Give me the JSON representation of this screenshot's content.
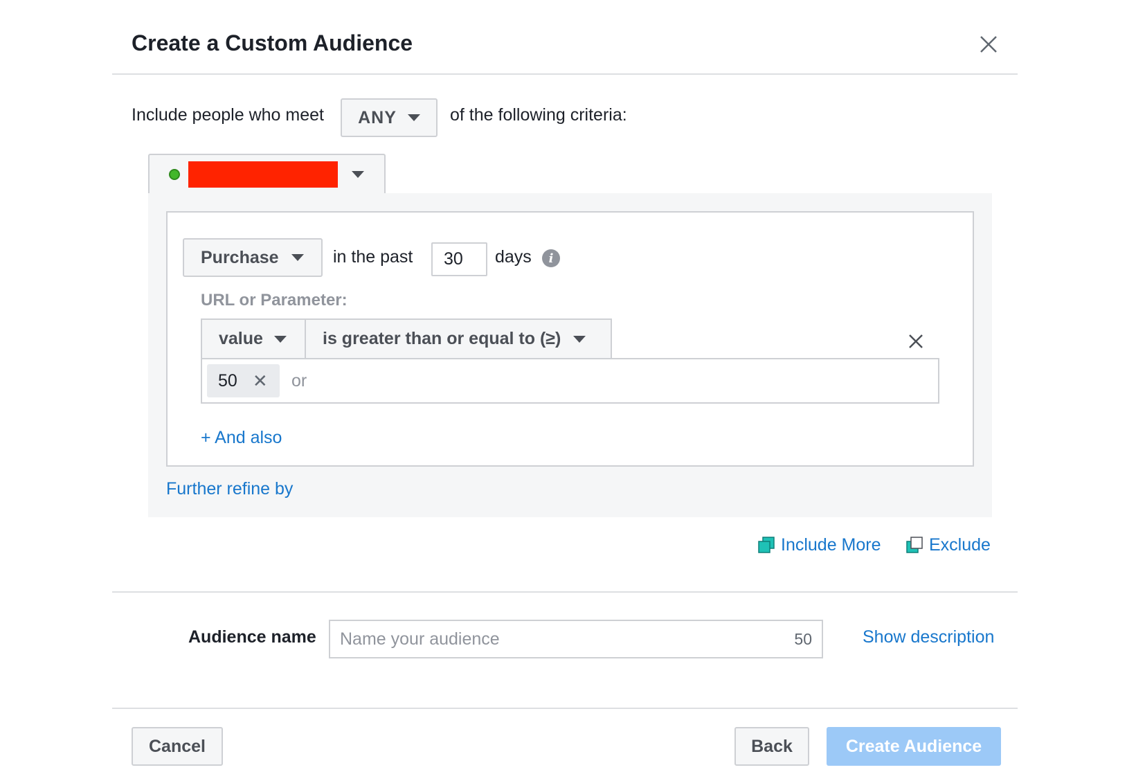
{
  "dialog": {
    "title": "Create a Custom Audience"
  },
  "criteria": {
    "prefix": "Include people who meet",
    "match_mode": "ANY",
    "suffix": "of the following criteria:"
  },
  "rule": {
    "event": "Purchase",
    "in_the_past_label": "in the past",
    "days_value": "30",
    "days_label": "days",
    "info_glyph": "i",
    "param_label": "URL or Parameter:",
    "param_key": "value",
    "operator": "is greater than or equal to (≥)",
    "tokens": [
      {
        "label": "50"
      }
    ],
    "or_label": "or",
    "and_also_link": "+ And also",
    "further_refine_link": "Further refine by"
  },
  "actions": {
    "include_more": "Include More",
    "exclude": "Exclude"
  },
  "audience_name": {
    "label": "Audience name",
    "placeholder": "Name your audience",
    "counter": "50",
    "show_description_link": "Show description"
  },
  "footer": {
    "cancel": "Cancel",
    "back": "Back",
    "create": "Create Audience"
  },
  "colors": {
    "link": "#1877cc",
    "accent_teal": "#1fc1b6",
    "primary_disabled": "#9cc9f7",
    "status_green": "#42b72a",
    "redaction": "#ff2300"
  }
}
